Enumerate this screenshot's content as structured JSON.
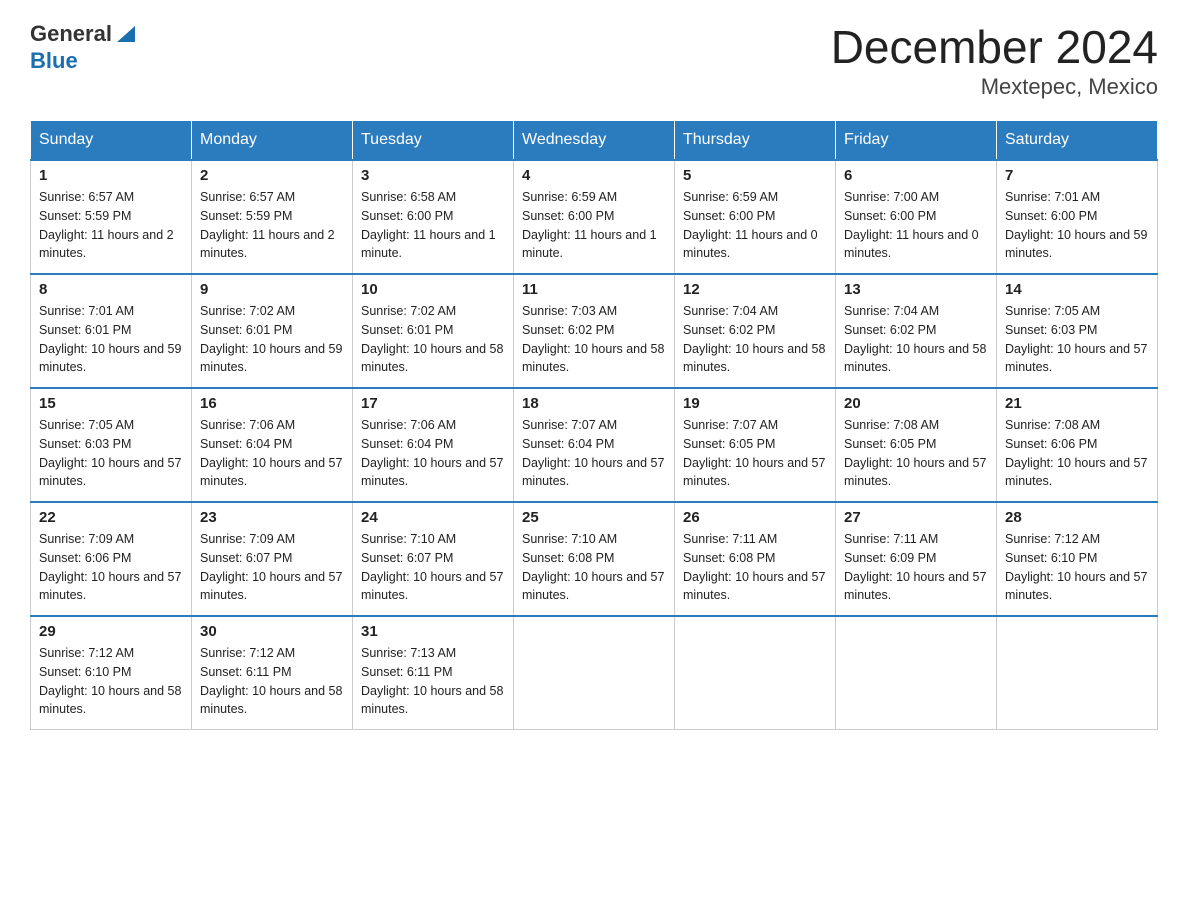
{
  "header": {
    "logo_text": "General",
    "logo_sub": "Blue",
    "month_title": "December 2024",
    "location": "Mextepec, Mexico"
  },
  "weekdays": [
    "Sunday",
    "Monday",
    "Tuesday",
    "Wednesday",
    "Thursday",
    "Friday",
    "Saturday"
  ],
  "weeks": [
    [
      {
        "day": "1",
        "sunrise": "6:57 AM",
        "sunset": "5:59 PM",
        "daylight": "11 hours and 2 minutes."
      },
      {
        "day": "2",
        "sunrise": "6:57 AM",
        "sunset": "5:59 PM",
        "daylight": "11 hours and 2 minutes."
      },
      {
        "day": "3",
        "sunrise": "6:58 AM",
        "sunset": "6:00 PM",
        "daylight": "11 hours and 1 minute."
      },
      {
        "day": "4",
        "sunrise": "6:59 AM",
        "sunset": "6:00 PM",
        "daylight": "11 hours and 1 minute."
      },
      {
        "day": "5",
        "sunrise": "6:59 AM",
        "sunset": "6:00 PM",
        "daylight": "11 hours and 0 minutes."
      },
      {
        "day": "6",
        "sunrise": "7:00 AM",
        "sunset": "6:00 PM",
        "daylight": "11 hours and 0 minutes."
      },
      {
        "day": "7",
        "sunrise": "7:01 AM",
        "sunset": "6:00 PM",
        "daylight": "10 hours and 59 minutes."
      }
    ],
    [
      {
        "day": "8",
        "sunrise": "7:01 AM",
        "sunset": "6:01 PM",
        "daylight": "10 hours and 59 minutes."
      },
      {
        "day": "9",
        "sunrise": "7:02 AM",
        "sunset": "6:01 PM",
        "daylight": "10 hours and 59 minutes."
      },
      {
        "day": "10",
        "sunrise": "7:02 AM",
        "sunset": "6:01 PM",
        "daylight": "10 hours and 58 minutes."
      },
      {
        "day": "11",
        "sunrise": "7:03 AM",
        "sunset": "6:02 PM",
        "daylight": "10 hours and 58 minutes."
      },
      {
        "day": "12",
        "sunrise": "7:04 AM",
        "sunset": "6:02 PM",
        "daylight": "10 hours and 58 minutes."
      },
      {
        "day": "13",
        "sunrise": "7:04 AM",
        "sunset": "6:02 PM",
        "daylight": "10 hours and 58 minutes."
      },
      {
        "day": "14",
        "sunrise": "7:05 AM",
        "sunset": "6:03 PM",
        "daylight": "10 hours and 57 minutes."
      }
    ],
    [
      {
        "day": "15",
        "sunrise": "7:05 AM",
        "sunset": "6:03 PM",
        "daylight": "10 hours and 57 minutes."
      },
      {
        "day": "16",
        "sunrise": "7:06 AM",
        "sunset": "6:04 PM",
        "daylight": "10 hours and 57 minutes."
      },
      {
        "day": "17",
        "sunrise": "7:06 AM",
        "sunset": "6:04 PM",
        "daylight": "10 hours and 57 minutes."
      },
      {
        "day": "18",
        "sunrise": "7:07 AM",
        "sunset": "6:04 PM",
        "daylight": "10 hours and 57 minutes."
      },
      {
        "day": "19",
        "sunrise": "7:07 AM",
        "sunset": "6:05 PM",
        "daylight": "10 hours and 57 minutes."
      },
      {
        "day": "20",
        "sunrise": "7:08 AM",
        "sunset": "6:05 PM",
        "daylight": "10 hours and 57 minutes."
      },
      {
        "day": "21",
        "sunrise": "7:08 AM",
        "sunset": "6:06 PM",
        "daylight": "10 hours and 57 minutes."
      }
    ],
    [
      {
        "day": "22",
        "sunrise": "7:09 AM",
        "sunset": "6:06 PM",
        "daylight": "10 hours and 57 minutes."
      },
      {
        "day": "23",
        "sunrise": "7:09 AM",
        "sunset": "6:07 PM",
        "daylight": "10 hours and 57 minutes."
      },
      {
        "day": "24",
        "sunrise": "7:10 AM",
        "sunset": "6:07 PM",
        "daylight": "10 hours and 57 minutes."
      },
      {
        "day": "25",
        "sunrise": "7:10 AM",
        "sunset": "6:08 PM",
        "daylight": "10 hours and 57 minutes."
      },
      {
        "day": "26",
        "sunrise": "7:11 AM",
        "sunset": "6:08 PM",
        "daylight": "10 hours and 57 minutes."
      },
      {
        "day": "27",
        "sunrise": "7:11 AM",
        "sunset": "6:09 PM",
        "daylight": "10 hours and 57 minutes."
      },
      {
        "day": "28",
        "sunrise": "7:12 AM",
        "sunset": "6:10 PM",
        "daylight": "10 hours and 57 minutes."
      }
    ],
    [
      {
        "day": "29",
        "sunrise": "7:12 AM",
        "sunset": "6:10 PM",
        "daylight": "10 hours and 58 minutes."
      },
      {
        "day": "30",
        "sunrise": "7:12 AM",
        "sunset": "6:11 PM",
        "daylight": "10 hours and 58 minutes."
      },
      {
        "day": "31",
        "sunrise": "7:13 AM",
        "sunset": "6:11 PM",
        "daylight": "10 hours and 58 minutes."
      },
      null,
      null,
      null,
      null
    ]
  ],
  "labels": {
    "sunrise": "Sunrise:",
    "sunset": "Sunset:",
    "daylight": "Daylight:"
  }
}
